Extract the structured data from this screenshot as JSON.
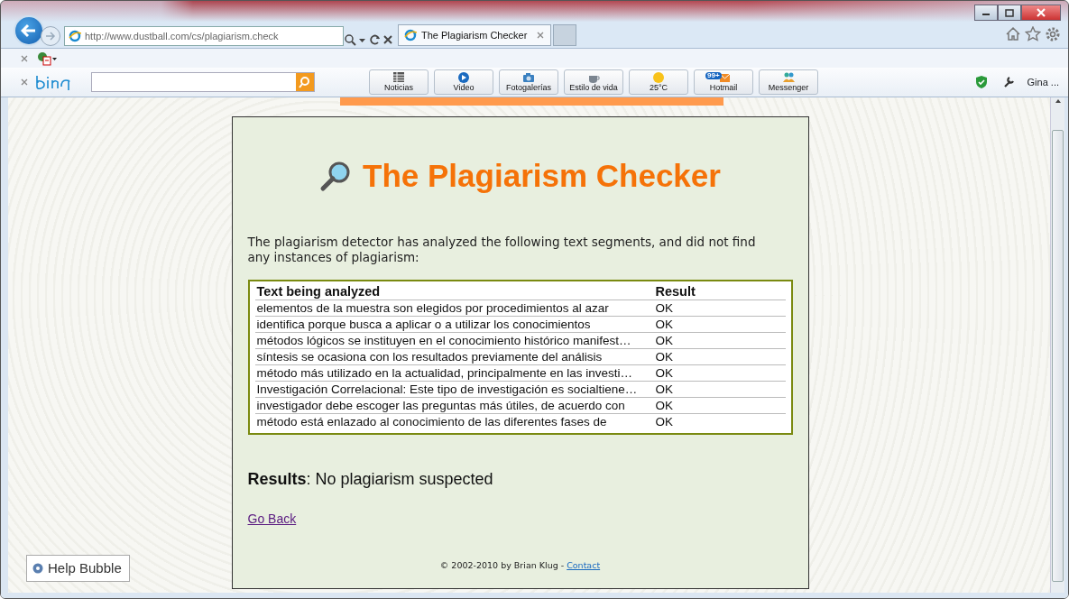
{
  "browser": {
    "address": "http://www.dustball.com/cs/plagiarism.check",
    "tab_title": "The Plagiarism Checker",
    "toolbar_buttons": [
      {
        "label": "Noticias",
        "kind": "news"
      },
      {
        "label": "Video",
        "kind": "video"
      },
      {
        "label": "Fotogalerías",
        "kind": "photo"
      },
      {
        "label": "Estilo de vida",
        "kind": "cup"
      },
      {
        "label": "25°C",
        "kind": "sun"
      },
      {
        "label": "Hotmail",
        "kind": "mail",
        "badge": "99+"
      },
      {
        "label": "Messenger",
        "kind": "people"
      }
    ],
    "user": "Gina ..."
  },
  "page": {
    "title": "The Plagiarism Checker",
    "intro": "The plagiarism detector has analyzed the following text segments, and did not find any instances of plagiarism:",
    "table": {
      "columns": [
        "Text being analyzed",
        "Result"
      ],
      "rows": [
        [
          "elementos de la muestra son elegidos por procedimientos al azar",
          "OK"
        ],
        [
          "identifica porque busca a aplicar o a utilizar los conocimientos",
          "OK"
        ],
        [
          "métodos lógicos se instituyen en el conocimiento histórico manifest…",
          "OK"
        ],
        [
          "síntesis se ocasiona con los resultados previamente del análisis",
          "OK"
        ],
        [
          "método más utilizado en la actualidad, principalmente en las investi…",
          "OK"
        ],
        [
          "Investigación Correlacional: Este tipo de investigación es socialtiene…",
          "OK"
        ],
        [
          "investigador debe escoger las preguntas más útiles, de acuerdo con",
          "OK"
        ],
        [
          "método está enlazado al conocimiento de las diferentes fases de",
          "OK"
        ]
      ]
    },
    "results": "**Results**: No plagiarism suspected",
    "back_link": "Go Back",
    "footer": "© 2002-2010 by Brian Klug - ",
    "contact_link": "Contact"
  },
  "help_bubble": "Help Bubble"
}
